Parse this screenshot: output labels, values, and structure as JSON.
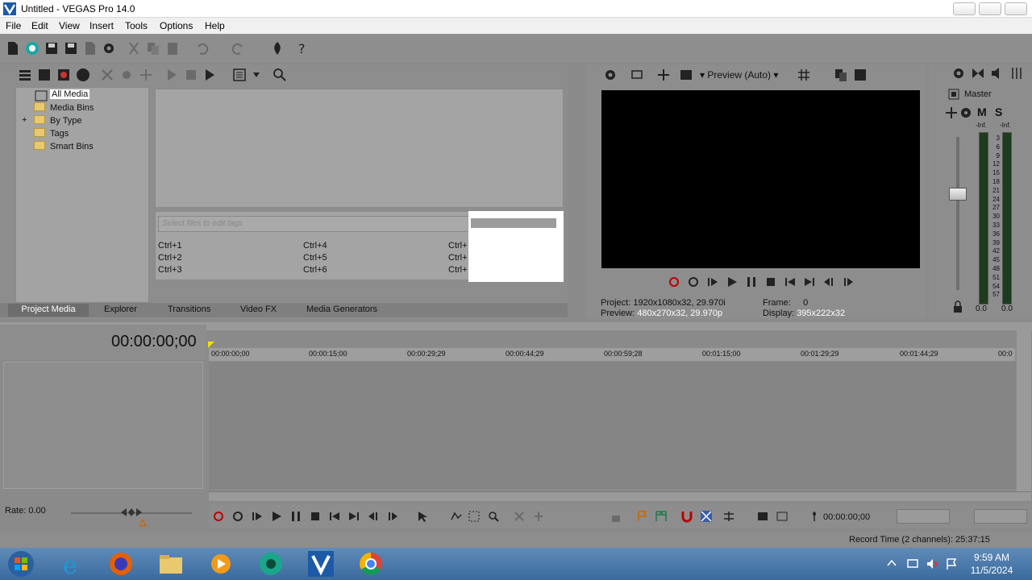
{
  "window": {
    "title": "Untitled - VEGAS Pro 14.0"
  },
  "menu": {
    "items": [
      "File",
      "Edit",
      "View",
      "Insert",
      "Tools",
      "Options",
      "Help"
    ]
  },
  "media": {
    "tree": [
      "All Media",
      "Media Bins",
      "By Type",
      "Tags",
      "Smart Bins"
    ],
    "tag_placeholder": "Select files to edit tags",
    "shortcuts": [
      "Ctrl+1",
      "Ctrl+2",
      "Ctrl+3",
      "Ctrl+4",
      "Ctrl+5",
      "Ctrl+6",
      "Ctrl+",
      "Ctrl+",
      "Ctrl+"
    ],
    "tabs": [
      "Project Media",
      "Explorer",
      "Transitions",
      "Video FX",
      "Media Generators"
    ]
  },
  "preview": {
    "mode_label": "Preview (Auto)",
    "project_label": "Project:",
    "project_value": "1920x1080x32, 29.970i",
    "preview_label": "Preview:",
    "preview_value": "480x270x32, 29.970p",
    "frame_label": "Frame:",
    "frame_value": "0",
    "display_label": "Display:",
    "display_value": "395x222x32"
  },
  "master": {
    "title": "Master",
    "m": "M",
    "s": "S",
    "inf_left": "-Inf.",
    "inf_right": "-Inf.",
    "scale": [
      "3",
      "6",
      "9",
      "12",
      "15",
      "18",
      "21",
      "24",
      "27",
      "30",
      "33",
      "36",
      "39",
      "42",
      "45",
      "48",
      "51",
      "54",
      "57"
    ],
    "bottom_left": "0.0",
    "bottom_right": "0.0"
  },
  "timeline": {
    "timecode": "00:00:00;00",
    "ruler": [
      "00:00:00;00",
      "00:00:15;00",
      "00:00:29;29",
      "00:00:44;29",
      "00:00:59;28",
      "00:01:15;00",
      "00:01:29;29",
      "00:01:44;29",
      "00:0"
    ],
    "rate": "Rate: 0.00",
    "transport_timecode": "00:00:00;00",
    "record_time": "Record Time (2 channels): 25:37:15"
  },
  "taskbar": {
    "time": "9:59 AM",
    "date": "11/5/2024"
  }
}
